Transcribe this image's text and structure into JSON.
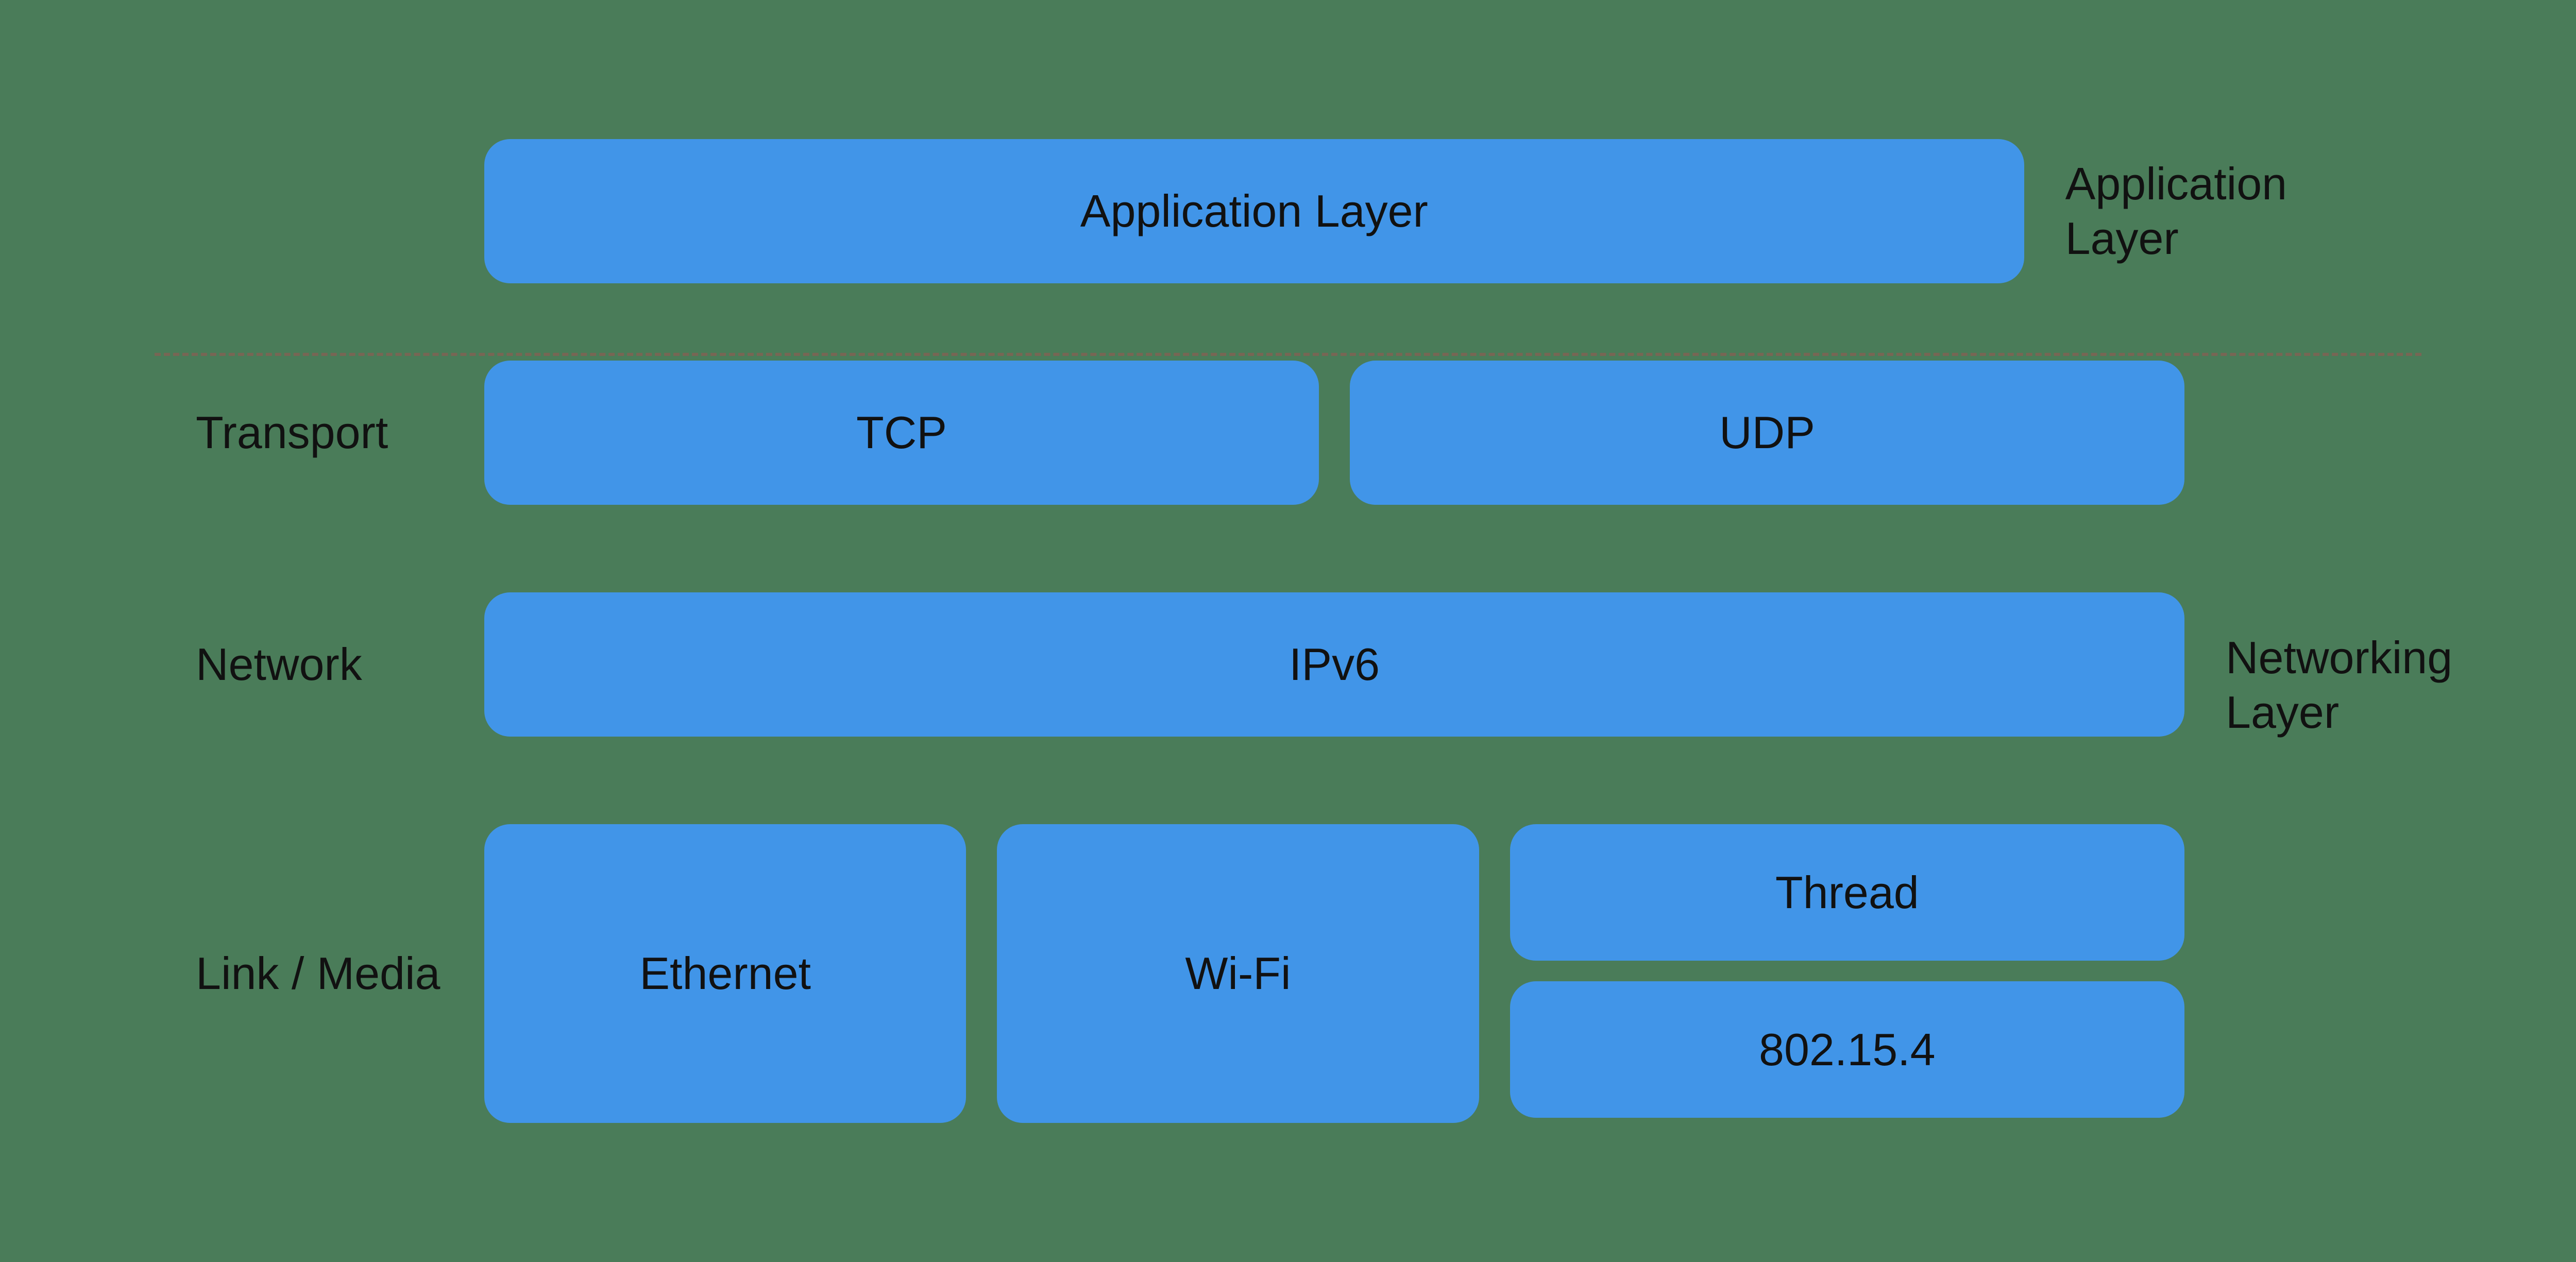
{
  "diagram": {
    "background": "#4a7c59",
    "layers": {
      "application": {
        "label": "",
        "block_text": "Application Layer",
        "right_label": "Application Layer"
      },
      "transport": {
        "label": "Transport",
        "tcp_label": "TCP",
        "udp_label": "UDP"
      },
      "network": {
        "label": "Network",
        "block_text": "IPv6",
        "right_label": "Networking Layer"
      },
      "link": {
        "label": "Link / Media",
        "ethernet_label": "Ethernet",
        "wifi_label": "Wi-Fi",
        "thread_label": "Thread",
        "ieee_label": "802.15.4"
      }
    }
  }
}
